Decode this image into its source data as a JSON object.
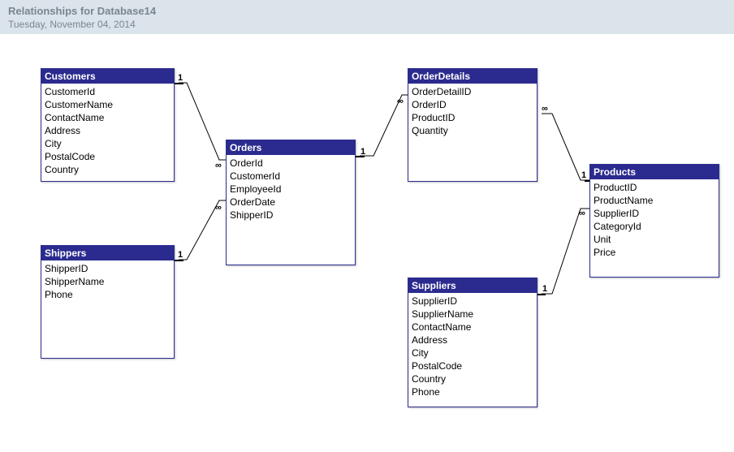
{
  "header": {
    "title": "Relationships for Database14",
    "date": "Tuesday, November 04, 2014"
  },
  "tables": {
    "customers": {
      "title": "Customers",
      "fields": [
        "CustomerId",
        "CustomerName",
        "ContactName",
        "Address",
        "City",
        "PostalCode",
        "Country"
      ]
    },
    "shippers": {
      "title": "Shippers",
      "fields": [
        "ShipperID",
        "ShipperName",
        "Phone"
      ]
    },
    "orders": {
      "title": "Orders",
      "fields": [
        "OrderId",
        "CustomerId",
        "EmployeeId",
        "OrderDate",
        "ShipperID"
      ]
    },
    "orderDetails": {
      "title": "OrderDetails",
      "fields": [
        "OrderDetailID",
        "OrderID",
        "ProductID",
        "Quantity"
      ]
    },
    "suppliers": {
      "title": "Suppliers",
      "fields": [
        "SupplierID",
        "SupplierName",
        "ContactName",
        "Address",
        "City",
        "PostalCode",
        "Country",
        "Phone"
      ]
    },
    "products": {
      "title": "Products",
      "fields": [
        "ProductID",
        "ProductName",
        "SupplierID",
        "CategoryId",
        "Unit",
        "Price"
      ]
    }
  },
  "relationships": [
    {
      "from": "customers",
      "to": "orders",
      "fromCard": "1",
      "toCard": "∞"
    },
    {
      "from": "shippers",
      "to": "orders",
      "fromCard": "1",
      "toCard": "∞"
    },
    {
      "from": "orders",
      "to": "orderDetails",
      "fromCard": "1",
      "toCard": "∞"
    },
    {
      "from": "orderDetails",
      "to": "products",
      "fromCard": "∞",
      "toCard": "1"
    },
    {
      "from": "suppliers",
      "to": "products",
      "fromCard": "1",
      "toCard": "∞"
    }
  ]
}
